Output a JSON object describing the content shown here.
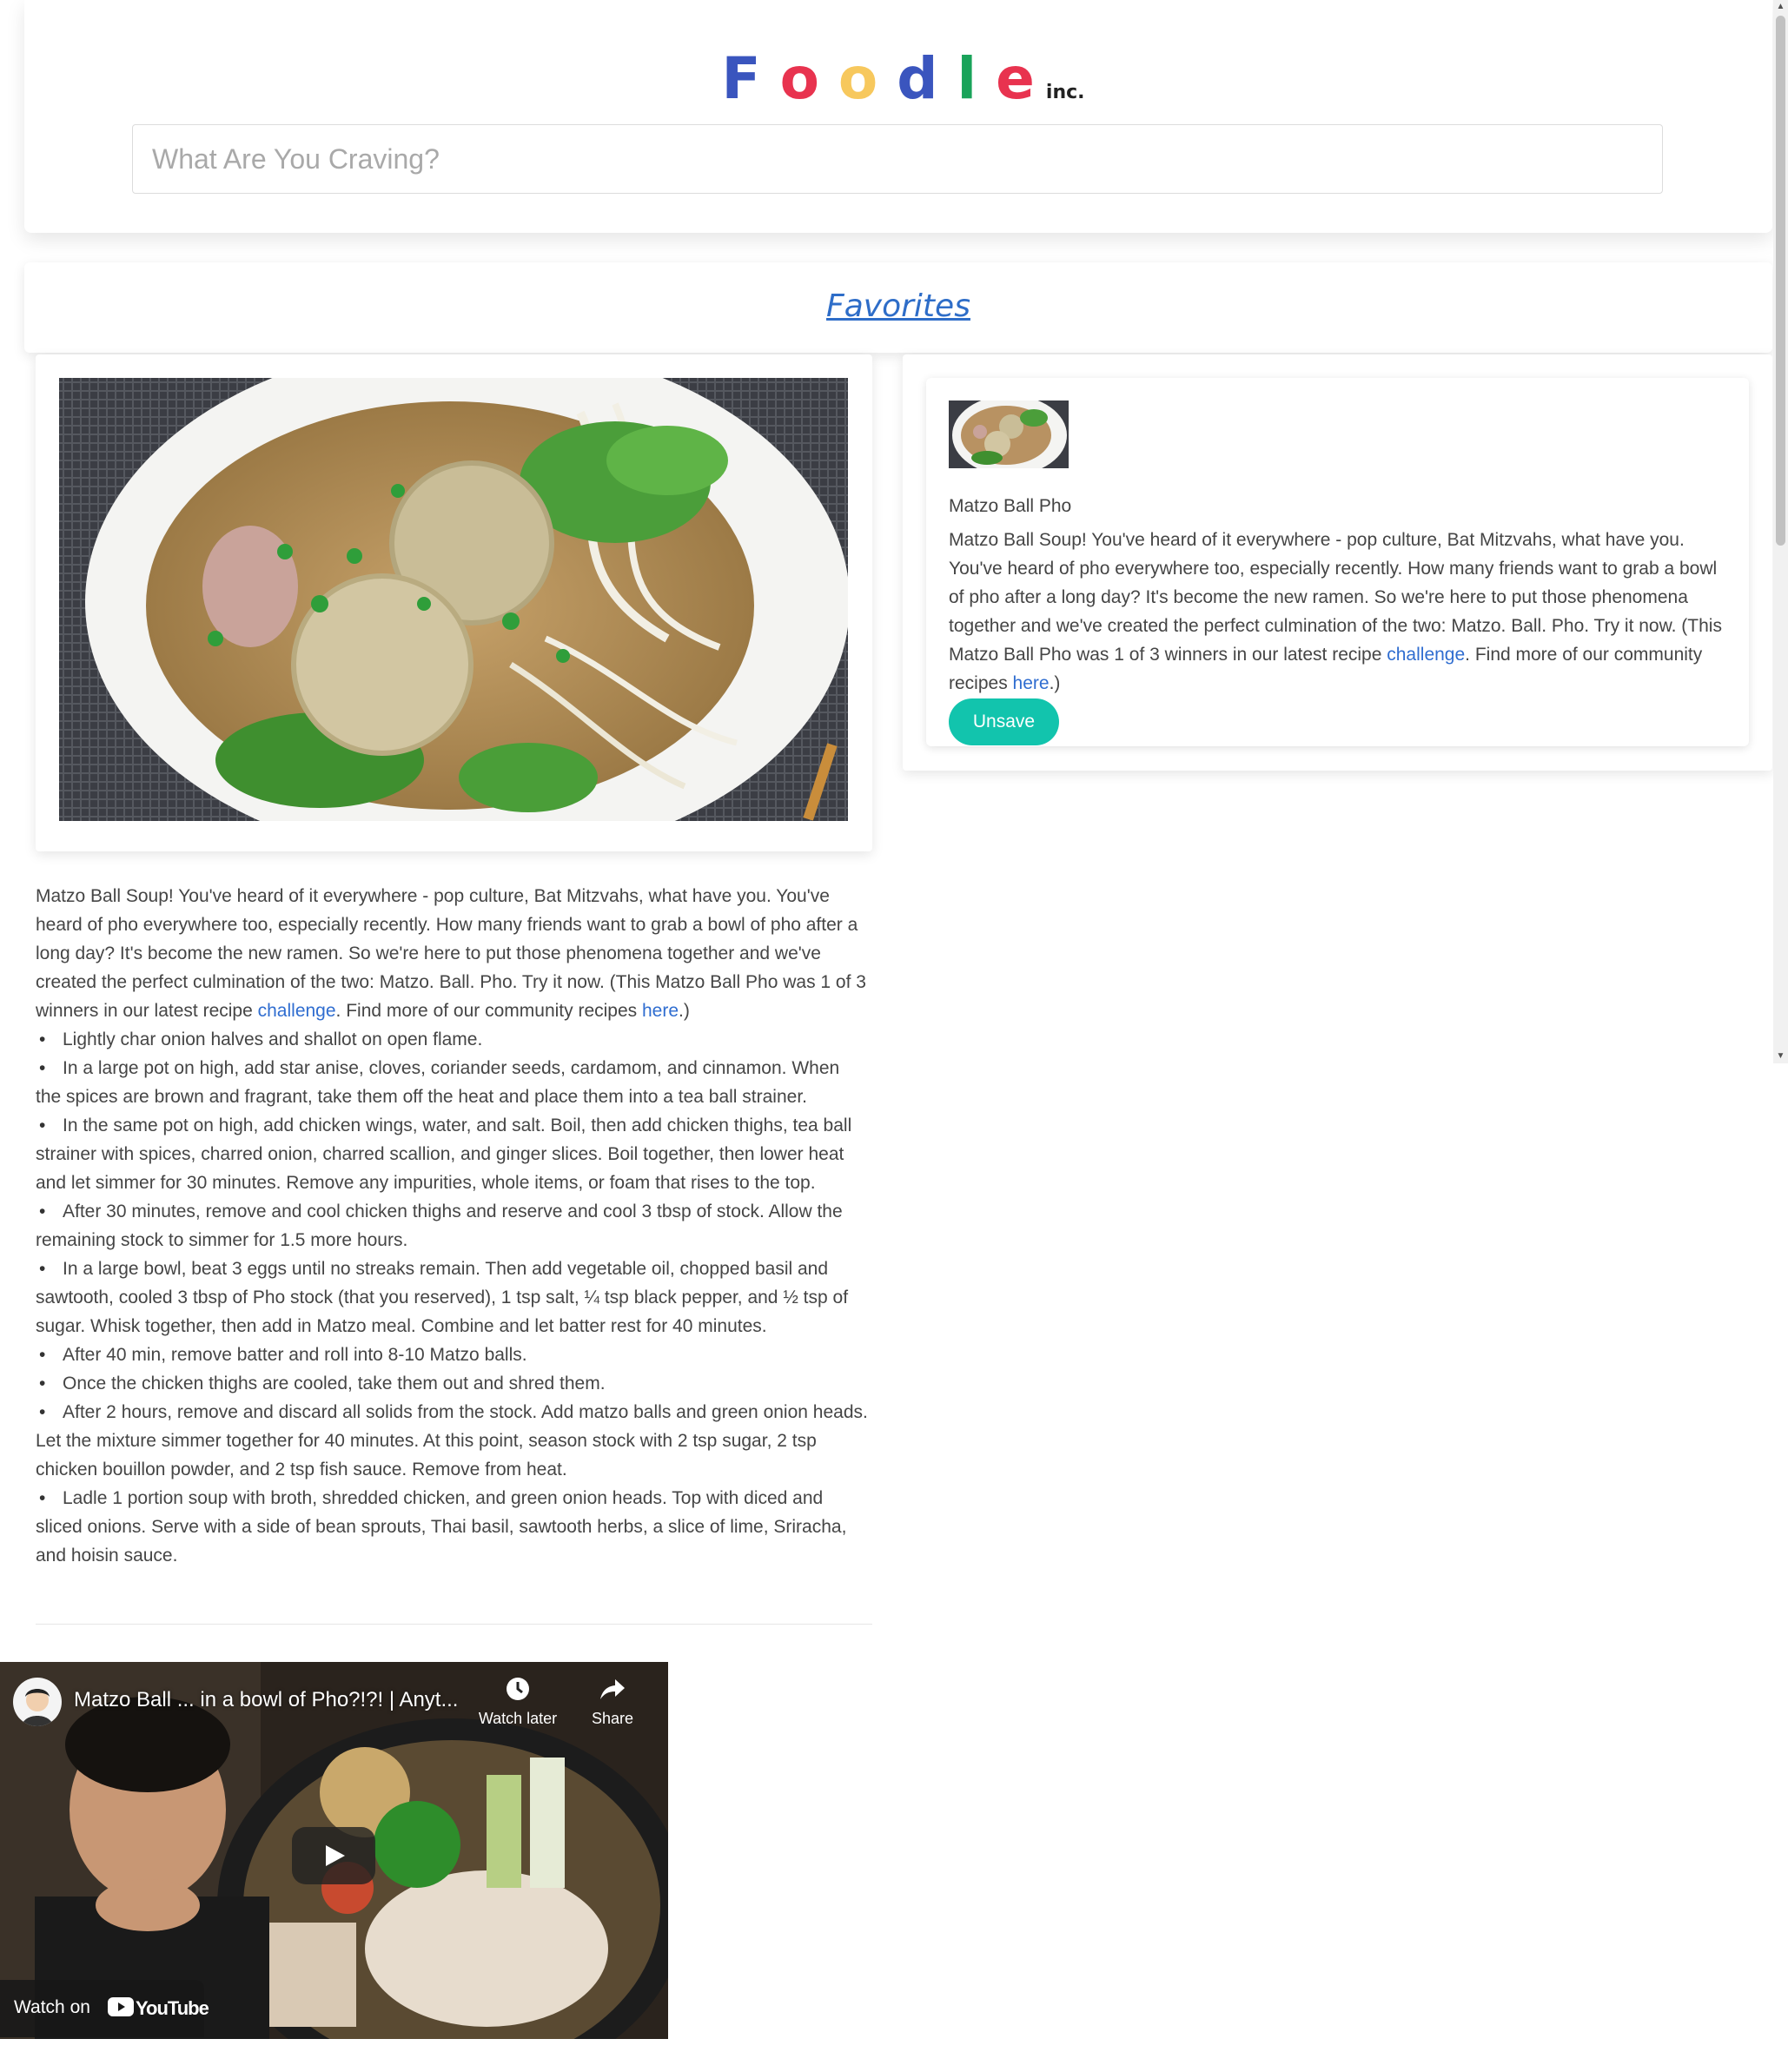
{
  "header": {
    "logo_letters": [
      {
        "char": "F",
        "color": "#3a55be"
      },
      {
        "char": "o",
        "color": "#e8334f"
      },
      {
        "char": "o",
        "color": "#f7c85d"
      },
      {
        "char": "d",
        "color": "#3a55be"
      },
      {
        "char": "l",
        "color": "#1aa35a"
      },
      {
        "char": "e",
        "color": "#e8334f"
      }
    ],
    "logo_suffix": "inc.",
    "search_placeholder": "What Are You Craving?"
  },
  "nav": {
    "favorites_label": "Favorites"
  },
  "recipe": {
    "title": "Matzo Ball Pho",
    "description_before_link1": "Matzo Ball Soup! You've heard of it everywhere - pop culture, Bat Mitzvahs, what have you. You've heard of pho everywhere too, especially recently. How many friends want to grab a bowl of pho after a long day? It's become the new ramen. So we're here to put those phenomena together and we've created the perfect culmination of the two: Matzo. Ball. Pho. Try it now. (This Matzo Ball Pho was 1 of 3 winners in our latest recipe ",
    "link1_text": "challenge",
    "description_between_links": ". Find more of our community recipes ",
    "link2_text": "here",
    "description_end": ".)",
    "steps": [
      "Lightly char onion halves and shallot on open flame.",
      "In a large pot on high, add star anise, cloves, coriander seeds, cardamom, and cinnamon. When the spices are brown and fragrant, take them off the heat and place them into a tea ball strainer.",
      "In the same pot on high, add chicken wings, water, and salt. Boil, then add chicken thighs, tea ball strainer with spices, charred onion, charred scallion, and ginger slices. Boil together, then lower heat and let simmer for 30 minutes. Remove any impurities, whole items, or foam that rises to the top.",
      "After 30 minutes, remove and cool chicken thighs and reserve and cool 3 tbsp of stock. Allow the remaining stock to simmer for 1.5 more hours.",
      "In a large bowl, beat 3 eggs until no streaks remain. Then add vegetable oil, chopped basil and sawtooth, cooled 3 tbsp of Pho stock (that you reserved), 1 tsp salt, ¼ tsp black pepper, and ½ tsp of sugar. Whisk together, then add in Matzo meal. Combine and let batter rest for 40 minutes.",
      "After 40 min, remove batter and roll into 8-10 Matzo balls.",
      "Once the chicken thighs are cooled, take them out and shred them.",
      "After 2 hours, remove and discard all solids from the stock. Add matzo balls and green onion heads. Let the mixture simmer together for 40 minutes. At this point, season stock with 2 tsp sugar, 2 tsp chicken bouillon powder, and 2 tsp fish sauce. Remove from heat.",
      "Ladle 1 portion soup with broth, shredded chicken, and green onion heads. Top with diced and sliced onions. Serve with a side of bean sprouts, Thai basil, sawtooth herbs, a slice of lime, Sriracha, and hoisin sauce."
    ]
  },
  "saved_card": {
    "title": "Matzo Ball Pho",
    "unsave_label": "Unsave"
  },
  "video": {
    "title": "Matzo Ball ... in a bowl of Pho?!?! | Anyt...",
    "watch_later_label": "Watch later",
    "share_label": "Share",
    "watch_on_label": "Watch on",
    "platform_label": "YouTube"
  },
  "colors": {
    "accent_button": "#12c4ad",
    "link": "#2f6dd0",
    "favorites_link": "#2e6dc8"
  }
}
